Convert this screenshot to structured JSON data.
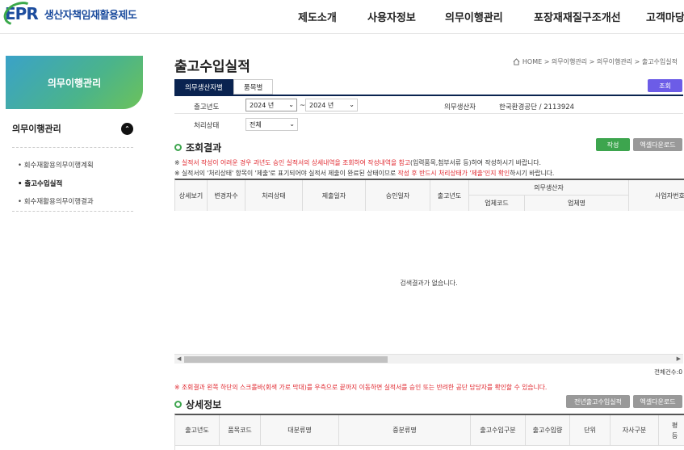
{
  "header": {
    "logo_mark": "EPR",
    "logo_text": "생산자책임재활용제도",
    "nav": [
      "제도소개",
      "사용자정보",
      "의무이행관리",
      "포장재재질구조개선",
      "고객마당"
    ]
  },
  "lnb": {
    "banner": "의무이행관리",
    "section": "의무이행관리",
    "toggle": "⌃",
    "items": [
      "회수재활용의무이행계획",
      "출고수입실적",
      "회수재활용의무이행결과"
    ]
  },
  "page": {
    "title": "출고수입실적",
    "breadcrumb": "HOME > 의무이행관리 > 의무이행관리 > 출고수입실적"
  },
  "tabs": [
    "의무생산자별",
    "품목별"
  ],
  "search": {
    "year_label": "출고년도",
    "year_from": "2024 년",
    "tilde": "~",
    "year_to": "2024 년",
    "producer_label": "의무생산자",
    "producer_value": "한국환경공단 / 2113924",
    "status_label": "처리상태",
    "status_value": "전체",
    "search_button": "조회"
  },
  "result": {
    "title": "조회결과",
    "create_button": "작성",
    "excel_button": "엑셀다운로드",
    "note1_prefix": "※ ",
    "note1_red": "실적서 작성이 어려운 경우 과년도 승인 실적서의 상세내역을 조회하여 작성내역을 참고",
    "note1_suffix": "(입력품목,첨부서류 등)하여 작성하시기 바랍니다.",
    "note2_prefix": "※ 실적서의 '처리상태' 항목이 '제출'로 표기되어야 실적서 제출이 완료된 상태이므로 ",
    "note2_red": "작성 후 반드시 처리상태가 '제출'인지 확인",
    "note2_suffix": "하시기 바랍니다.",
    "headers": [
      "상세보기",
      "변경자수",
      "처리상태",
      "제출일자",
      "승인일자",
      "출고년도",
      "의무생산자",
      "업체코드",
      "업체명",
      "사업자번호"
    ],
    "empty": "검색결과가 없습니다.",
    "total": "전체건수:0",
    "warning": "※ 조회결과 왼쪽 하단의 스크롤바(회색 가로 막대)를 우측으로 끝까지 이동하면 실적서를 승인 또는 반려한 공단 담당자를 확인할 수 있습니다."
  },
  "detail": {
    "title": "상세정보",
    "prev_button": "전년출고수입실적",
    "excel_button": "엑셀다운로드",
    "headers": [
      "출고년도",
      "품목코드",
      "대분류명",
      "중분류명",
      "출고수입구분",
      "출고수입량",
      "단위",
      "자사구분",
      "평\n등"
    ]
  }
}
